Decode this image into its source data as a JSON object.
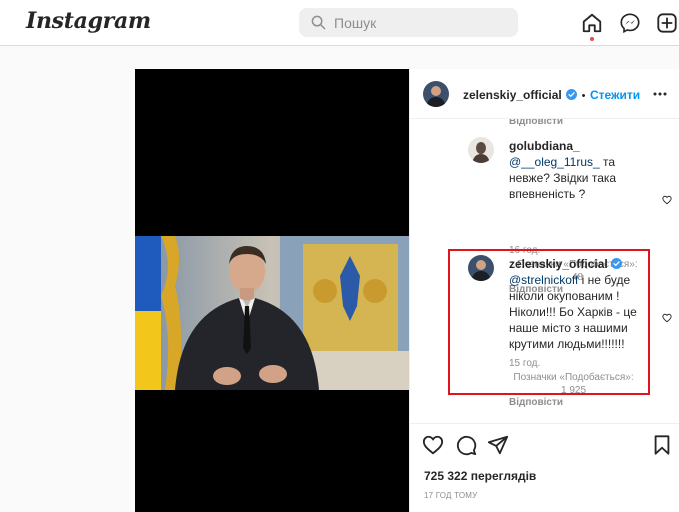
{
  "app": {
    "logo_text": "Instagram"
  },
  "search": {
    "placeholder": "Пошук"
  },
  "colors": {
    "accent": "#0095f6",
    "verified": "#3897f0",
    "highlight": "#e0141c",
    "notification": "#ed4956"
  },
  "post": {
    "author": "zelenskiy_official",
    "separator": "•",
    "follow_label": "Стежити",
    "more_icon": "more-dots-icon"
  },
  "comments": [
    {
      "reply_label": "Відповісти"
    },
    {
      "username": "golubdiana_",
      "mention": "@__oleg_11rus_",
      "text": " та невже? Звідки така впевненість ?",
      "time": "16 год.",
      "likes_label": "Позначки «Подобається»:",
      "likes": "48",
      "reply_label": "Відповісти"
    },
    {
      "username": "zelenskiy_official",
      "mention": "@strelnickoff",
      "text": " і не буде ніколи окупованим ! Ніколи!!! Бо Харків - це наше місто з нашими крутими людьми!!!!!!!",
      "time": "15 год.",
      "likes_label": "Позначки «Подобається»:",
      "likes": "1 925",
      "reply_label": "Відповісти"
    }
  ],
  "stats": {
    "views": "725 322 переглядів",
    "time_ago": "17 ГОД ТОМУ"
  }
}
